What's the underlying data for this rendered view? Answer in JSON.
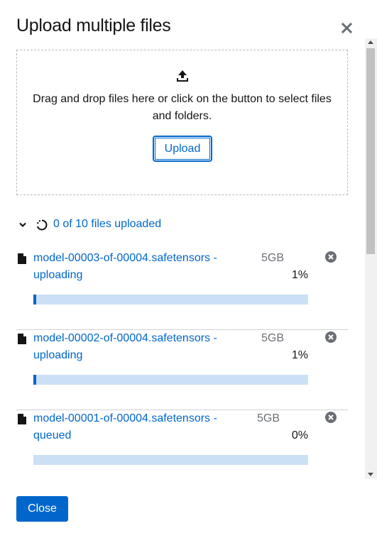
{
  "modal": {
    "title": "Upload multiple files",
    "close_label": "Close"
  },
  "dropzone": {
    "text": "Drag and drop files here or click on the button to select files and folders.",
    "upload_label": "Upload"
  },
  "status": {
    "text": "0 of 10 files uploaded"
  },
  "files": [
    {
      "name": "model-00003-of-00004.safetensors - uploading",
      "size": "5GB",
      "percent_label": "1%",
      "progress": 1
    },
    {
      "name": "model-00002-of-00004.safetensors - uploading",
      "size": "5GB",
      "percent_label": "1%",
      "progress": 1
    },
    {
      "name": "model-00001-of-00004.safetensors - queued",
      "size": "5GB",
      "percent_label": "0%",
      "progress": 0
    }
  ],
  "colors": {
    "primary": "#0066cc",
    "progress_track": "#cce0f5",
    "text": "#151515",
    "muted": "#6a6e73"
  }
}
